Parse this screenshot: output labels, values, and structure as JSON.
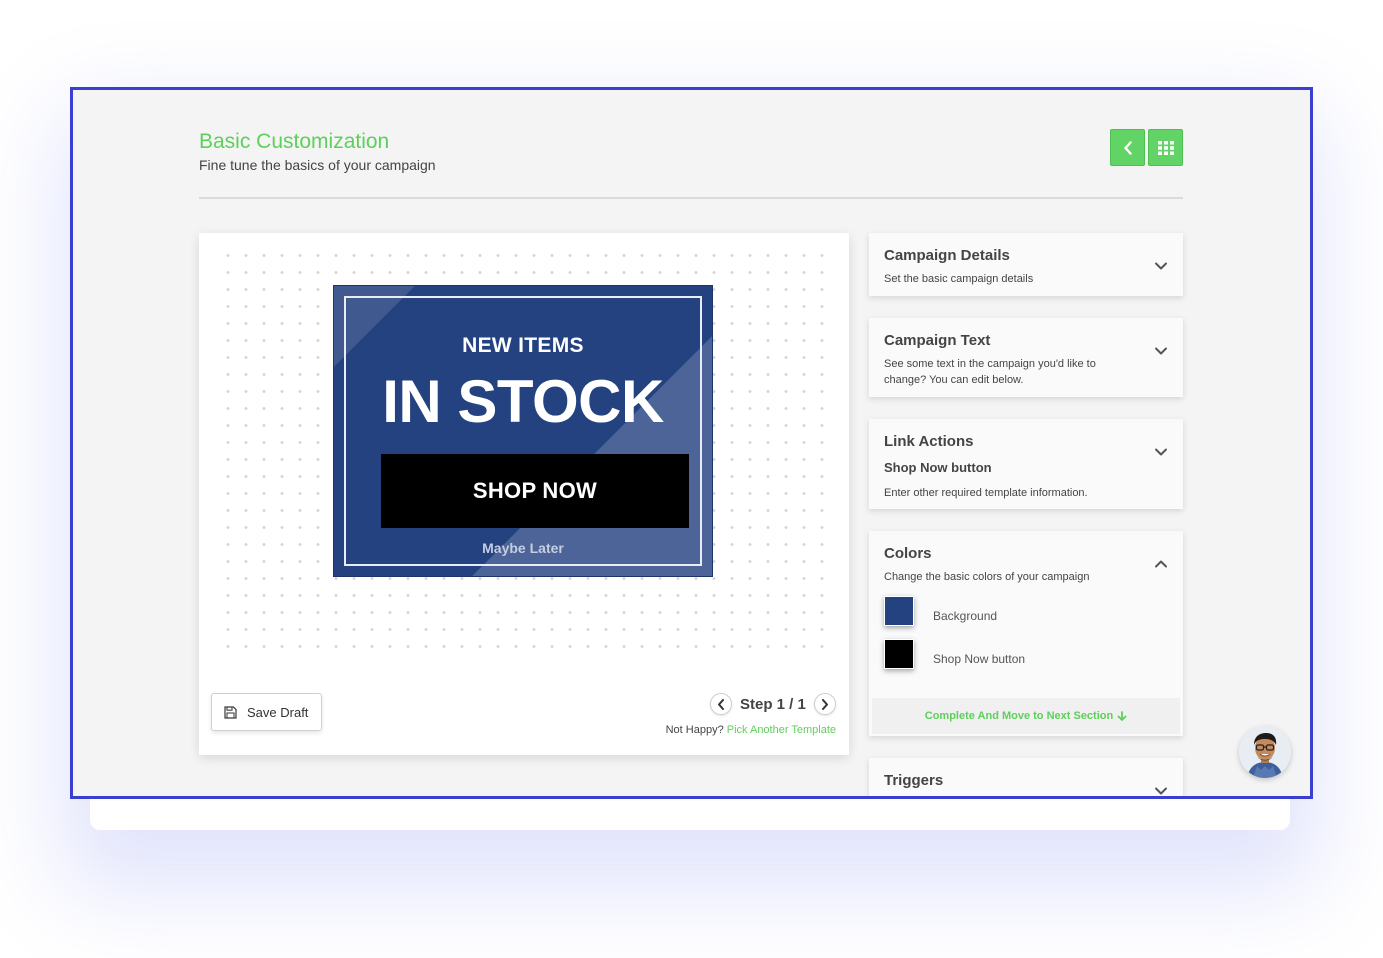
{
  "header": {
    "title": "Basic Customization",
    "subtitle": "Fine tune the basics of your campaign",
    "back_button_icon": "chevron-left-icon",
    "grid_button_icon": "grid-icon",
    "accent_color": "#5fcf5b"
  },
  "preview": {
    "banner": {
      "headline_small": "NEW ITEMS",
      "headline_large": "IN STOCK",
      "cta_label": "SHOP NOW",
      "dismiss_label": "Maybe Later",
      "background_color": "#244280"
    },
    "save_draft_label": "Save Draft",
    "step_text": "Step 1 / 1",
    "not_happy_text": "Not Happy?",
    "pick_template_link": "Pick Another Template"
  },
  "sections": {
    "campaign_details": {
      "title": "Campaign Details",
      "subtitle": "Set the basic campaign details",
      "expanded": false
    },
    "campaign_text": {
      "title": "Campaign Text",
      "subtitle_line1": "See some text in the campaign you'd like to",
      "subtitle_line2": "change? You can edit below.",
      "expanded": false
    },
    "link_actions": {
      "title": "Link Actions",
      "item": "Shop Now button",
      "subtitle": "Enter other required template information.",
      "expanded": false
    },
    "colors": {
      "title": "Colors",
      "subtitle": "Change the basic colors of your campaign",
      "expanded": true,
      "items": [
        {
          "label": "Background",
          "color": "#244280"
        },
        {
          "label": "Shop Now button",
          "color": "#000000"
        }
      ],
      "complete_label": "Complete And Move to Next Section"
    },
    "triggers": {
      "title": "Triggers",
      "expanded": false
    }
  }
}
